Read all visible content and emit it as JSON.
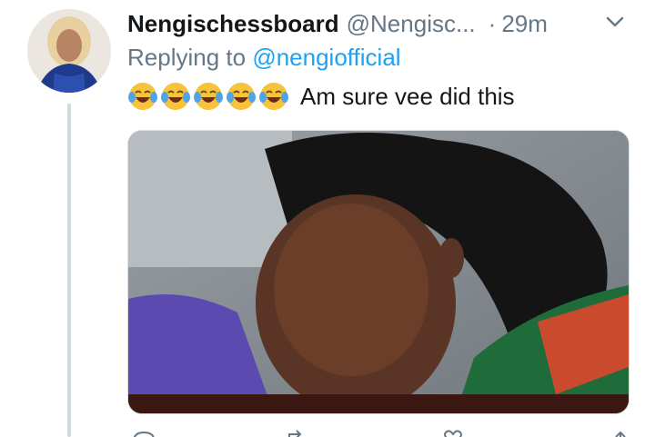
{
  "tweet": {
    "display_name": "Nengischessboard",
    "handle": "@Nengisc...",
    "separator": "·",
    "time": "29m",
    "reply_prefix": "Replying to",
    "reply_mention": "@nengiofficial",
    "text": "Am sure vee did this",
    "emoji": [
      "face-with-tears-of-joy-icon",
      "face-with-tears-of-joy-icon",
      "face-with-tears-of-joy-icon",
      "face-with-tears-of-joy-icon",
      "face-with-tears-of-joy-icon"
    ]
  },
  "colors": {
    "name": "#14171a",
    "secondary": "#657786",
    "link": "#1da1f2",
    "thread_line": "#cfd9de"
  },
  "icons": {
    "menu": "chevron-down-icon",
    "actions": [
      "reply-icon",
      "retweet-icon",
      "like-icon",
      "share-icon"
    ]
  }
}
